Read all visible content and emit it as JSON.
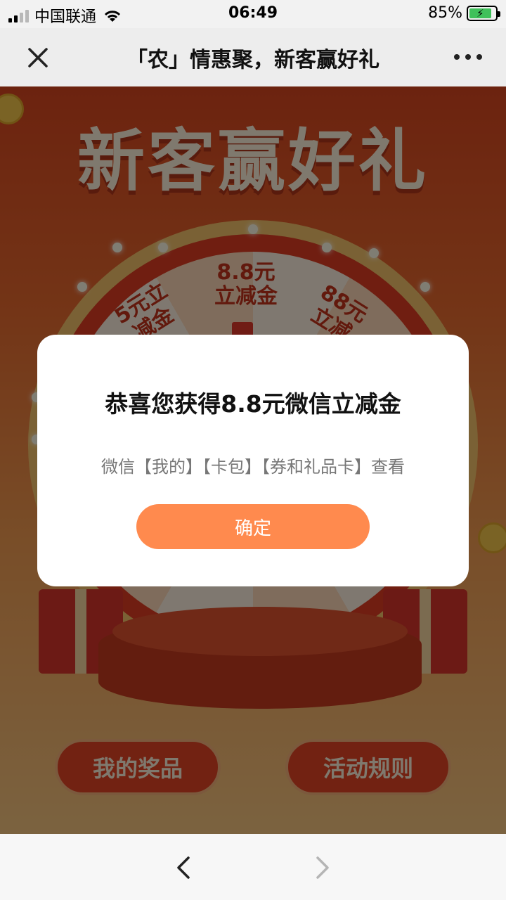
{
  "status_bar": {
    "carrier": "中国联通",
    "time": "06:49",
    "battery_percent": "85%",
    "battery_level": 0.85,
    "icons": [
      "signal-icon",
      "wifi-icon",
      "battery-charging-icon"
    ]
  },
  "nav": {
    "title": "「农」情惠聚，新客赢好礼",
    "icons": [
      "close-icon",
      "more-icon"
    ]
  },
  "banner": {
    "title": "新客赢好礼"
  },
  "wheel": {
    "prizes": [
      "5元立减金",
      "8.8元立减金",
      "88元立减"
    ]
  },
  "buttons": {
    "my_prizes": "我的奖品",
    "rules": "活动规则"
  },
  "dialog": {
    "title": "恭喜您获得8.8元微信立减金",
    "subtitle": "微信【我的】【卡包】【券和礼品卡】查看",
    "confirm_label": "确定"
  },
  "toolbar": {
    "icons": [
      "back-arrow-icon",
      "forward-arrow-icon"
    ]
  },
  "colors": {
    "accent_orange": "#ff8a4e",
    "page_red": "#d9461f",
    "battery_green": "#3fc15a"
  }
}
